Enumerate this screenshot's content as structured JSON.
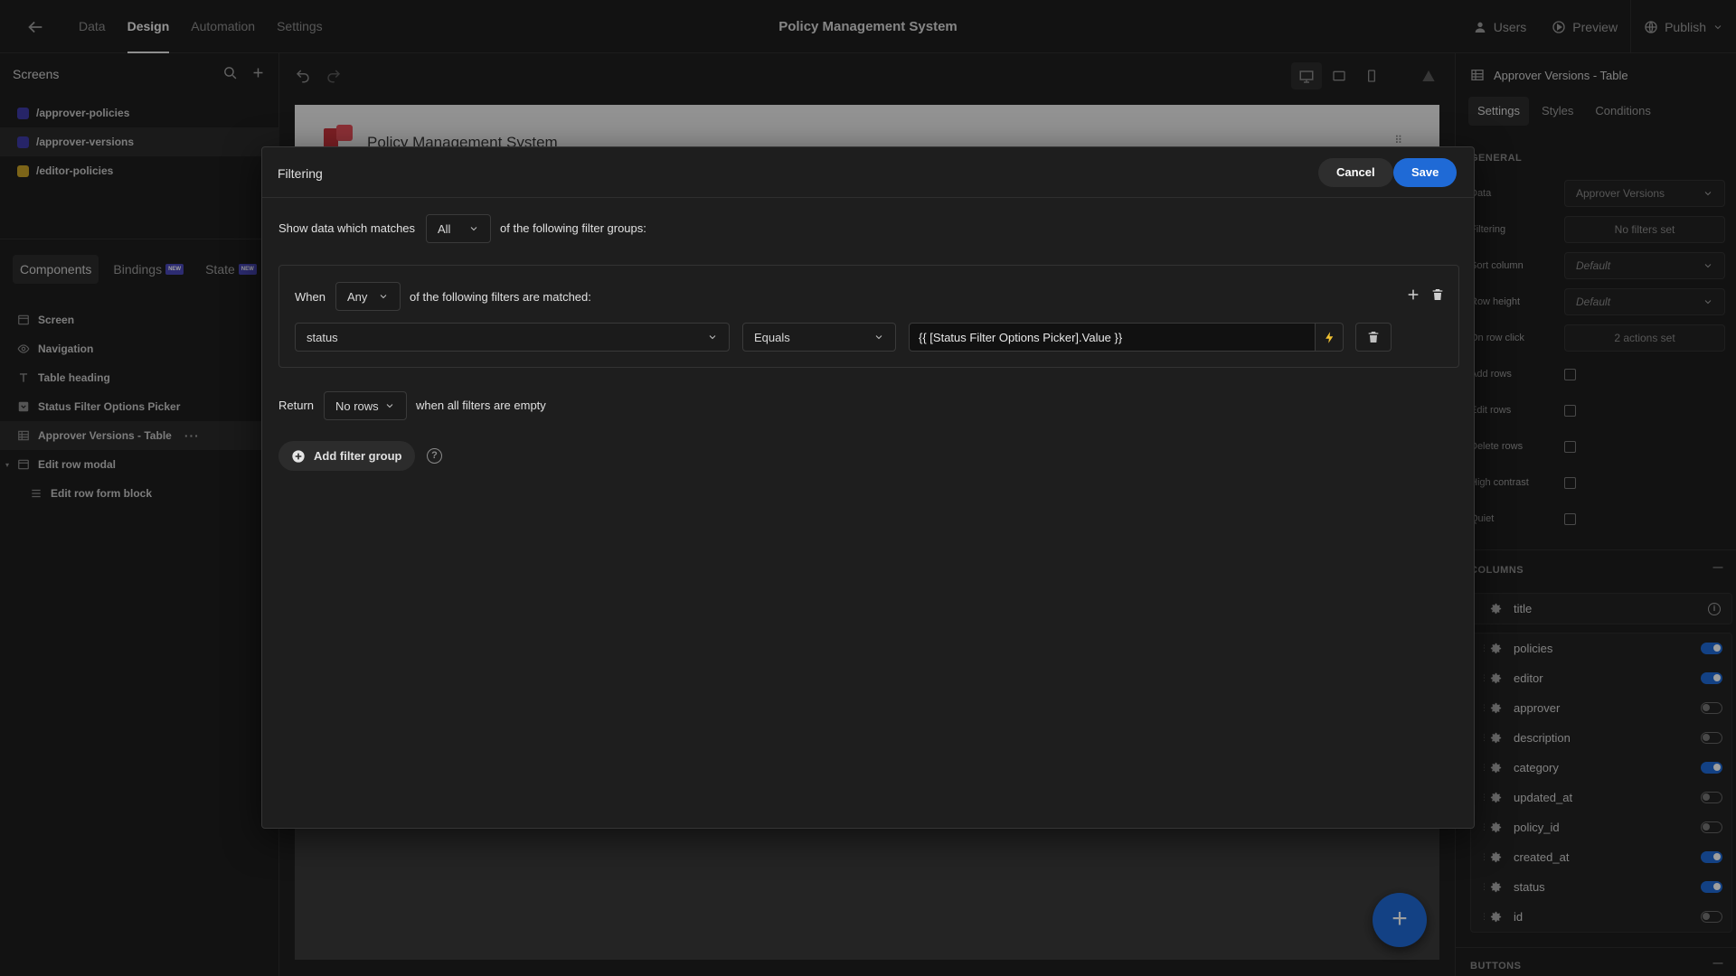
{
  "app": {
    "title": "Policy Management System"
  },
  "nav": {
    "tabs": [
      {
        "label": "Data"
      },
      {
        "label": "Design"
      },
      {
        "label": "Automation"
      },
      {
        "label": "Settings"
      }
    ]
  },
  "top_actions": {
    "users": "Users",
    "preview": "Preview",
    "publish": "Publish"
  },
  "left": {
    "screens_header": "Screens",
    "screens": [
      {
        "path": "/approver-policies",
        "color": "#3e3aa6"
      },
      {
        "path": "/approver-versions",
        "color": "#3e3aa6"
      },
      {
        "path": "/editor-policies",
        "color": "#c9a227"
      }
    ],
    "tabs": [
      {
        "label": "Components"
      },
      {
        "label": "Bindings",
        "badge": "NEW"
      },
      {
        "label": "State",
        "badge": "NEW"
      }
    ],
    "tree": [
      {
        "label": "Screen",
        "icon": "screen-icon"
      },
      {
        "label": "Navigation",
        "icon": "eye-icon"
      },
      {
        "label": "Table heading",
        "icon": "text-icon"
      },
      {
        "label": "Status Filter Options Picker",
        "icon": "picker-icon"
      },
      {
        "label": "Approver Versions - Table",
        "icon": "table-icon"
      },
      {
        "label": "Edit row modal",
        "icon": "modal-icon"
      },
      {
        "label": "Edit row form block",
        "icon": "form-icon"
      }
    ]
  },
  "canvas": {
    "title": "Policy Management System",
    "fab": "+"
  },
  "right": {
    "title": "Approver Versions - Table",
    "tabs": [
      {
        "label": "Settings"
      },
      {
        "label": "Styles"
      },
      {
        "label": "Conditions"
      }
    ],
    "general_label": "GENERAL",
    "settings": [
      {
        "label": "Data",
        "value": "Approver Versions"
      },
      {
        "label": "Filtering",
        "value": "No filters set"
      },
      {
        "label": "Sort column",
        "value": "Default"
      },
      {
        "label": "Row height",
        "value": "Default"
      },
      {
        "label": "On row click",
        "value": "2 actions set"
      }
    ],
    "checks": [
      {
        "label": "Add rows"
      },
      {
        "label": "Edit rows"
      },
      {
        "label": "Delete rows"
      },
      {
        "label": "High contrast"
      },
      {
        "label": "Quiet"
      }
    ],
    "columns_label": "COLUMNS",
    "columns_minus": "—",
    "title_column": "title",
    "columns": [
      {
        "name": "policies",
        "on": true
      },
      {
        "name": "editor",
        "on": true
      },
      {
        "name": "approver",
        "on": false
      },
      {
        "name": "description",
        "on": false
      },
      {
        "name": "category",
        "on": true
      },
      {
        "name": "updated_at",
        "on": false
      },
      {
        "name": "policy_id",
        "on": false
      },
      {
        "name": "created_at",
        "on": true
      },
      {
        "name": "status",
        "on": true
      },
      {
        "name": "id",
        "on": false
      }
    ],
    "buttons_label": "BUTTONS"
  },
  "modal": {
    "title": "Filtering",
    "cancel": "Cancel",
    "save": "Save",
    "show_prefix": "Show data which matches",
    "match_mode": "All",
    "show_suffix": "of the following filter groups:",
    "group": {
      "when": "When",
      "mode": "Any",
      "suffix": "of the following filters are matched:",
      "field": "status",
      "operator": "Equals",
      "value": "{{ [Status Filter Options Picker].Value }}"
    },
    "return_label": "Return",
    "return_value": "No rows",
    "return_suffix": "when all filters are empty",
    "add_group": "Add filter group",
    "help": "?"
  }
}
